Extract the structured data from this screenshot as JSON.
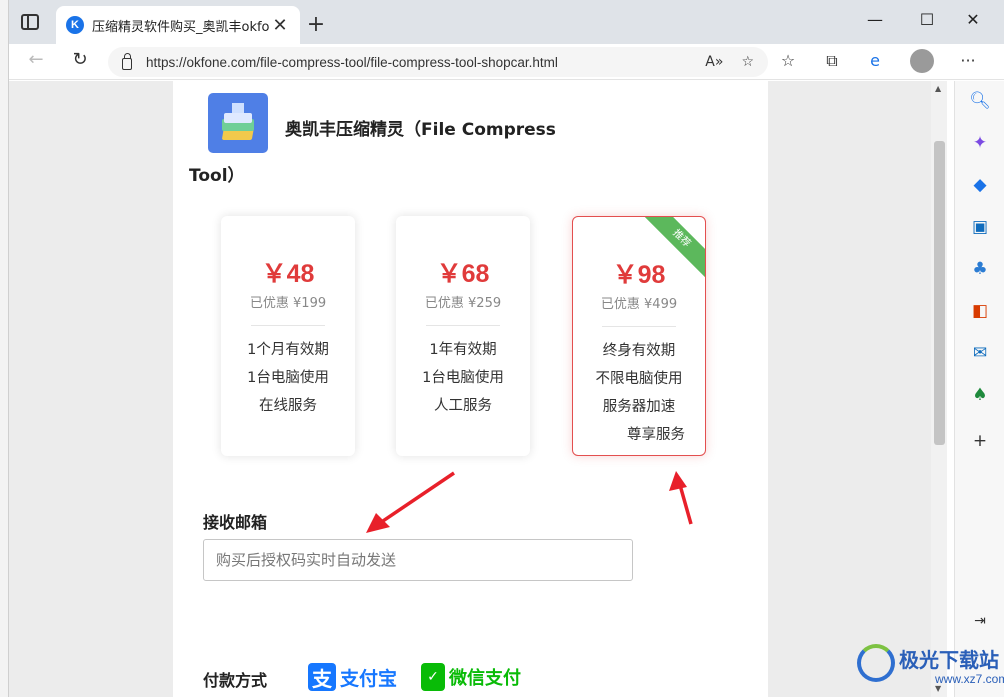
{
  "tab": {
    "favicon_letter": "K",
    "title": "压缩精灵软件购买_奥凯丰okfone",
    "close": "✕",
    "new_tab": "+"
  },
  "window_controls": {
    "minimize": "—",
    "maximize": "☐",
    "close": "✕"
  },
  "address": {
    "url": "https://okfone.com/file-compress-tool/file-compress-tool-shopcar.html"
  },
  "product": {
    "name": "奥凯丰压缩精灵（File Compress Tool）"
  },
  "plans": [
    {
      "price": "￥48",
      "discount": "已优惠 ¥199",
      "features": [
        "1个月有效期",
        "1台电脑使用",
        "在线服务"
      ]
    },
    {
      "price": "￥68",
      "discount": "已优惠 ¥259",
      "features": [
        "1年有效期",
        "1台电脑使用",
        "人工服务"
      ]
    },
    {
      "price": "￥98",
      "discount": "已优惠 ¥499",
      "badge": "推荐",
      "features": [
        "终身有效期",
        "不限电脑使用",
        "服务器加速",
        "尊享服务"
      ]
    }
  ],
  "email": {
    "label": "接收邮箱",
    "placeholder": "购买后授权码实时自动发送"
  },
  "payment": {
    "label": "付款方式",
    "alipay": "支付宝",
    "alipay_mark": "支",
    "wechat": "微信支付",
    "wechat_mark": "✓"
  },
  "watermark": {
    "text": "极光下载站",
    "url": "www.xz7.com"
  },
  "colors": {
    "price_red": "#e03b3b",
    "badge_green": "#5cb85c",
    "alipay_blue": "#1677ff",
    "wechat_green": "#09bb07"
  }
}
